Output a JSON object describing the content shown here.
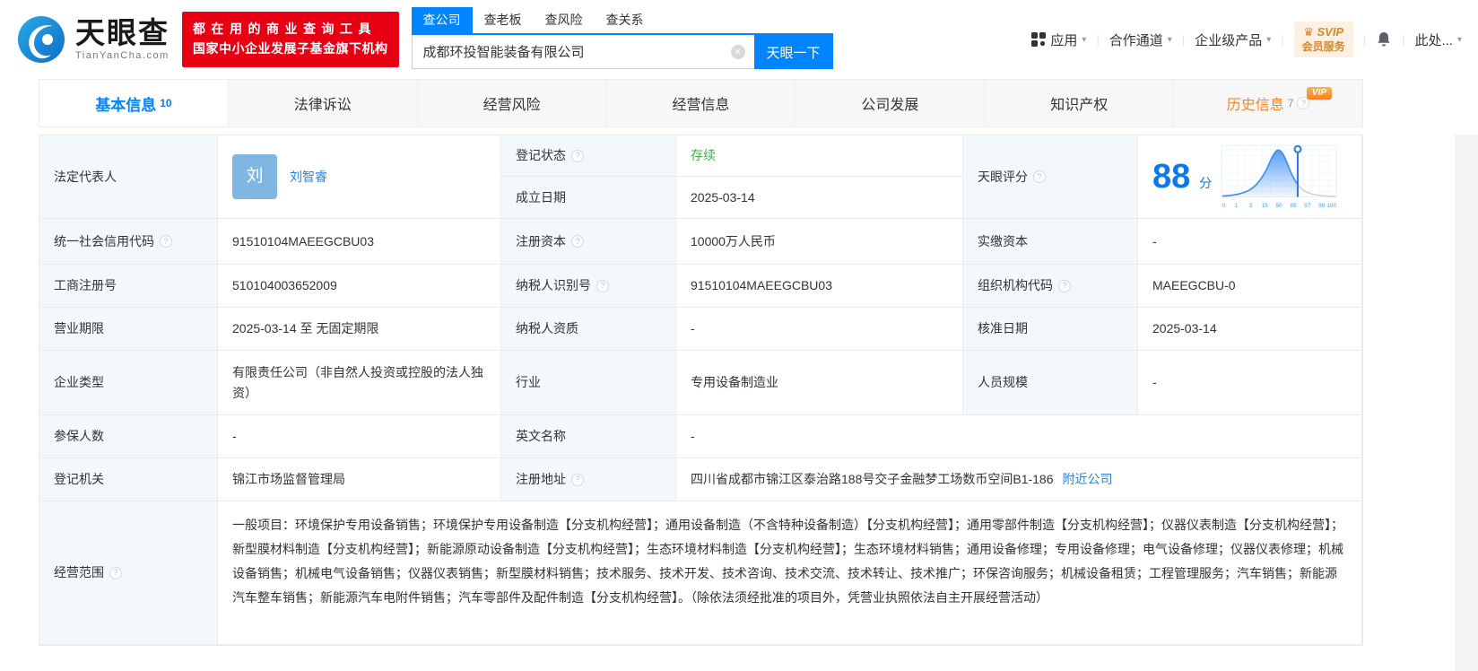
{
  "icons": {
    "help": "?",
    "clear": "✕",
    "caret": "▾",
    "crown": "♛"
  },
  "header": {
    "logo": {
      "brand": "天眼查",
      "domain": "TianYanCha.com"
    },
    "slogan": {
      "line1": "都在用的商业查询工具",
      "line2": "国家中小企业发展子基金旗下机构"
    },
    "search": {
      "tabs": [
        "查公司",
        "查老板",
        "查风险",
        "查关系"
      ],
      "value": "成都环投智能装备有限公司",
      "button": "天眼一下"
    },
    "nav": {
      "apps": "应用",
      "partner": "合作通道",
      "enterprise": "企业级产品"
    },
    "svip": {
      "line1": "SVIP",
      "line2": "会员服务"
    },
    "user": "此处..."
  },
  "tabs": {
    "basic": {
      "label": "基本信息",
      "count": "10"
    },
    "legal": {
      "label": "法律诉讼"
    },
    "risk": {
      "label": "经营风险"
    },
    "operation": {
      "label": "经营信息"
    },
    "development": {
      "label": "公司发展"
    },
    "ip": {
      "label": "知识产权"
    },
    "history": {
      "label": "历史信息",
      "count": "7",
      "badge": "VIP"
    }
  },
  "fields": {
    "legal_rep": {
      "label": "法定代表人",
      "avatar": "刘",
      "name": "刘智睿"
    },
    "reg_status": {
      "label": "登记状态",
      "value": "存续"
    },
    "est_date": {
      "label": "成立日期",
      "value": "2025-03-14"
    },
    "score": {
      "label": "天眼评分",
      "value": "88",
      "unit": "分"
    },
    "credit_code": {
      "label": "统一社会信用代码",
      "value": "91510104MAEEGCBU03"
    },
    "reg_capital": {
      "label": "注册资本",
      "value": "10000万人民币"
    },
    "paid_capital": {
      "label": "实缴资本",
      "value": "-"
    },
    "reg_number": {
      "label": "工商注册号",
      "value": "510104003652009"
    },
    "taxpayer_id": {
      "label": "纳税人识别号",
      "value": "91510104MAEEGCBU03"
    },
    "org_code": {
      "label": "组织机构代码",
      "value": "MAEEGCBU-0"
    },
    "business_term": {
      "label": "营业期限",
      "value": "2025-03-14 至 无固定期限"
    },
    "taxpayer_quality": {
      "label": "纳税人资质",
      "value": "-"
    },
    "approval_date": {
      "label": "核准日期",
      "value": "2025-03-14"
    },
    "company_type": {
      "label": "企业类型",
      "value": "有限责任公司（非自然人投资或控股的法人独资）"
    },
    "industry": {
      "label": "行业",
      "value": "专用设备制造业"
    },
    "staff_size": {
      "label": "人员规模",
      "value": "-"
    },
    "insured_count": {
      "label": "参保人数",
      "value": "-"
    },
    "english_name": {
      "label": "英文名称",
      "value": "-"
    },
    "reg_authority": {
      "label": "登记机关",
      "value": "锦江市场监督管理局"
    },
    "reg_address": {
      "label": "注册地址",
      "value": "四川省成都市锦江区泰治路188号交子金融梦工场数币空间B1-186",
      "link": "附近公司"
    },
    "business_scope": {
      "label": "经营范围",
      "value": "一般项目：环境保护专用设备销售；环境保护专用设备制造【分支机构经营】；通用设备制造（不含特种设备制造）【分支机构经营】；通用零部件制造【分支机构经营】；仪器仪表制造【分支机构经营】；新型膜材料制造【分支机构经营】；新能源原动设备制造【分支机构经营】；生态环境材料制造【分支机构经营】；生态环境材料销售；通用设备修理；专用设备修理；电气设备修理；仪器仪表修理；机械设备销售；机械电气设备销售；仪器仪表销售；新型膜材料销售；技术服务、技术开发、技术咨询、技术交流、技术转让、技术推广；环保咨询服务；机械设备租赁；工程管理服务；汽车销售；新能源汽车整车销售；新能源汽车电附件销售；汽车零部件及配件制造【分支机构经营】。（除依法须经批准的项目外，凭营业执照依法自主开展经营活动）"
    }
  },
  "score_chart": {
    "type": "area",
    "score": 88,
    "ticks": [
      "0",
      "1",
      "3",
      "15",
      "50",
      "85",
      "97",
      "99",
      "100"
    ],
    "marker_value": 88,
    "accent_color": "#3b8df2",
    "tail_color": "#c9ced4"
  }
}
